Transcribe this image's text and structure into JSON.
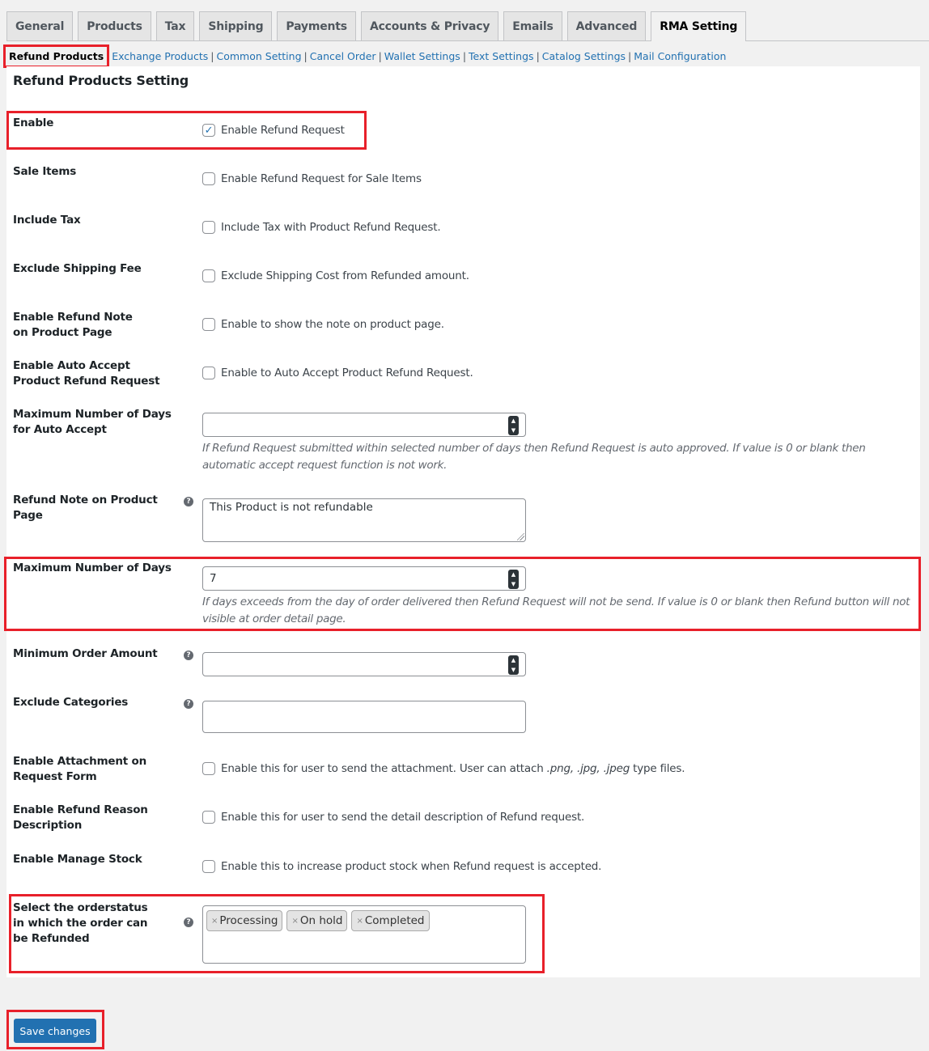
{
  "tabs": [
    {
      "label": "General",
      "active": false
    },
    {
      "label": "Products",
      "active": false
    },
    {
      "label": "Tax",
      "active": false
    },
    {
      "label": "Shipping",
      "active": false
    },
    {
      "label": "Payments",
      "active": false
    },
    {
      "label": "Accounts & Privacy",
      "active": false
    },
    {
      "label": "Emails",
      "active": false
    },
    {
      "label": "Advanced",
      "active": false
    },
    {
      "label": "RMA Setting",
      "active": true
    }
  ],
  "subnav": {
    "current": "Refund Products",
    "links": [
      "Exchange Products",
      "Common Setting",
      "Cancel Order",
      "Wallet Settings",
      "Text Settings",
      "Catalog Settings",
      "Mail Configuration"
    ]
  },
  "section_title": "Refund Products Setting",
  "fields": {
    "enable": {
      "label": "Enable",
      "checkbox_label": "Enable Refund Request",
      "checked": true
    },
    "sale_items": {
      "label": "Sale Items",
      "checkbox_label": "Enable Refund Request for Sale Items",
      "checked": false
    },
    "include_tax": {
      "label": "Include Tax",
      "checkbox_label": "Include Tax with Product Refund Request.",
      "checked": false
    },
    "exclude_shipping": {
      "label": "Exclude Shipping Fee",
      "checkbox_label": "Exclude Shipping Cost from Refunded amount.",
      "checked": false
    },
    "refund_note_enable": {
      "label": "Enable Refund Note on Product Page",
      "checkbox_label": "Enable to show the note on product page.",
      "checked": false
    },
    "auto_accept": {
      "label": "Enable Auto Accept Product Refund Request",
      "checkbox_label": "Enable to Auto Accept Product Refund Request.",
      "checked": false
    },
    "auto_accept_days": {
      "label": "Maximum Number of Days for Auto Accept",
      "value": "",
      "description": "If Refund Request submitted within selected number of days then Refund Request is auto approved. If value is 0 or blank then automatic accept request function is not work."
    },
    "refund_note": {
      "label": "Refund Note on Product Page",
      "value": "This Product is not refundable"
    },
    "max_days": {
      "label": "Maximum Number of Days",
      "value": "7",
      "description": "If days exceeds from the day of order delivered then Refund Request will not be send. If value is 0 or blank then Refund button will not visible at order detail page."
    },
    "min_order_amount": {
      "label": "Minimum Order Amount",
      "value": ""
    },
    "exclude_categories": {
      "label": "Exclude Categories",
      "value": ""
    },
    "attachment": {
      "label": "Enable Attachment on Request Form",
      "checkbox_label_pre": "Enable this for user to send the attachment. User can attach ",
      "checkbox_label_em": ".png, .jpg, .jpeg",
      "checkbox_label_post": " type files.",
      "checked": false
    },
    "reason_desc": {
      "label": "Enable Refund Reason Description",
      "checkbox_label": "Enable this for user to send the detail description of Refund request.",
      "checked": false
    },
    "manage_stock": {
      "label": "Enable Manage Stock",
      "checkbox_label": "Enable this to increase product stock when Refund request is accepted.",
      "checked": false
    },
    "order_status": {
      "label": "Select the orderstatus in which the order can be Refunded",
      "selected": [
        "Processing",
        "On hold",
        "Completed"
      ],
      "remove_glyph": "×"
    }
  },
  "icons": {
    "help": "?",
    "check": "✓",
    "spin_up": "^",
    "spin_down": "v"
  },
  "save_label": "Save changes",
  "colors": {
    "accent": "#2271b1",
    "highlight": "#e8202a"
  }
}
